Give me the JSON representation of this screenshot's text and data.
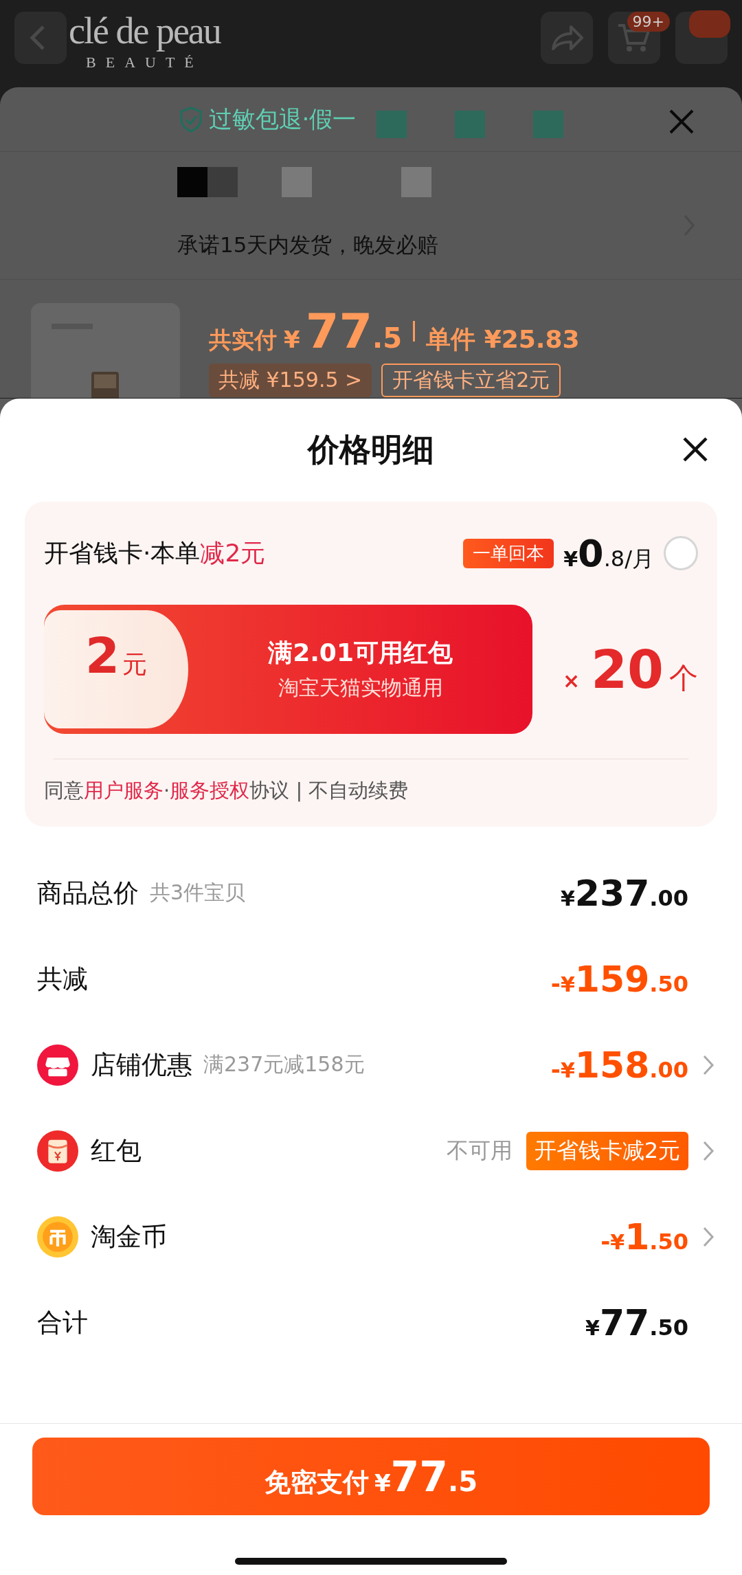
{
  "background": {
    "header": {
      "logo_main": "clé de peau",
      "logo_sub": "BEAUTÉ",
      "cart_badge": "99+"
    },
    "notice_panel": {
      "guarantee": "过敏包退·假一",
      "shipping": "承诺15天内发货，晚发必赔"
    },
    "product": {
      "pay_label": "共实付",
      "currency": "¥",
      "price_int": "77",
      "price_dec": ".5",
      "unit_price": "单件 ¥25.83",
      "discount_tag": "共减 ¥159.5 >",
      "card_tag": "开省钱卡立省2元"
    }
  },
  "sheet": {
    "title": "价格明细",
    "savings_card": {
      "title": "开省钱卡·本单",
      "title_highlight": "减2元",
      "badge": "一单回本",
      "currency": "¥",
      "price_int": "0",
      "price_rest": ".8/月",
      "checked": false,
      "coupon": {
        "amount": "2",
        "unit": "元",
        "condition": "满2.01可用红包",
        "scope": "淘宝天猫实物通用",
        "times": "×",
        "count": "20",
        "count_unit": "个"
      },
      "agreement": [
        {
          "kind": "text",
          "text": "同意"
        },
        {
          "kind": "link",
          "text": "用户服务"
        },
        {
          "kind": "text",
          "text": "·"
        },
        {
          "kind": "link",
          "text": "服务授权"
        },
        {
          "kind": "text",
          "text": "协议 | 不自动续费"
        }
      ]
    },
    "rows": [
      {
        "kind": "plain",
        "label": "商品总价",
        "note": "共3件宝贝",
        "sign": "",
        "currency": "¥",
        "int": "237",
        "dec": ".00",
        "discount": false,
        "arrow": false
      },
      {
        "kind": "plain",
        "label": "共减",
        "sign": "-",
        "currency": "¥",
        "int": "159",
        "dec": ".50",
        "discount": true,
        "arrow": false
      },
      {
        "kind": "store",
        "label": "店铺优惠",
        "note": "满237元减158元",
        "sign": "-",
        "currency": "¥",
        "int": "158",
        "dec": ".00",
        "discount": true,
        "arrow": true
      },
      {
        "kind": "redpacket",
        "label": "红包",
        "status": "不可用",
        "tag": "开省钱卡减2元",
        "arrow": true
      },
      {
        "kind": "coin",
        "label": "淘金币",
        "sign": "-",
        "currency": "¥",
        "int": "1",
        "dec": ".50",
        "discount": true,
        "arrow": true
      },
      {
        "kind": "plain",
        "label": "合计",
        "sign": "",
        "currency": "¥",
        "int": "77",
        "dec": ".50",
        "discount": false,
        "arrow": false
      }
    ],
    "pay_button": {
      "label": "免密支付",
      "currency": "¥",
      "int": "77",
      "dec": ".5"
    }
  }
}
